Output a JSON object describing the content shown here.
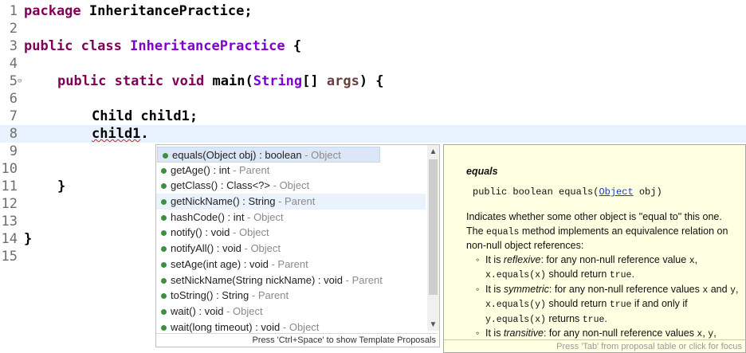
{
  "editor": {
    "lines": [
      {
        "n": "1",
        "tokens": [
          [
            "kw",
            "package"
          ],
          [
            "",
            "InheritancePractice;"
          ]
        ]
      },
      {
        "n": "2",
        "tokens": []
      },
      {
        "n": "3",
        "tokens": [
          [
            "kw",
            "public"
          ],
          [
            "kw",
            "class"
          ],
          [
            "cls",
            "InheritancePractice"
          ],
          [
            "",
            "{"
          ]
        ]
      },
      {
        "n": "4",
        "tokens": []
      },
      {
        "n": "5",
        "tokens": []
      },
      {
        "n": "6",
        "tokens": []
      },
      {
        "n": "7",
        "tokens": []
      },
      {
        "n": "8",
        "tokens": []
      },
      {
        "n": "9",
        "tokens": []
      },
      {
        "n": "10",
        "tokens": []
      },
      {
        "n": "11",
        "tokens": []
      },
      {
        "n": "12",
        "tokens": []
      },
      {
        "n": "13",
        "tokens": []
      },
      {
        "n": "14",
        "tokens": []
      },
      {
        "n": "15",
        "tokens": []
      }
    ],
    "line5_fold_marker": "⊖",
    "line5": {
      "kw1": "public",
      "kw2": "static",
      "kw3": "void",
      "method": "main(",
      "type": "String",
      "rest": "[] ",
      "param": "args",
      "close": ") {"
    },
    "line7": "Child child1;",
    "line8_ident": "child1",
    "line8_dot": ".",
    "line11": "}",
    "line14": "}",
    "line1_pkg_kw": "package",
    "line1_pkg": "InheritancePractice;",
    "line3_kw1": "public",
    "line3_kw2": "class",
    "line3_cls": "InheritancePractice",
    "line3_brace": "{"
  },
  "completion": {
    "items": [
      {
        "sig": "equals(Object obj) : boolean",
        "owner": "Object",
        "selected": true
      },
      {
        "sig": "getAge() : int",
        "owner": "Parent"
      },
      {
        "sig": "getClass() : Class<?>",
        "owner": "Object"
      },
      {
        "sig": "getNickName() : String",
        "owner": "Parent",
        "hover": true
      },
      {
        "sig": "hashCode() : int",
        "owner": "Object"
      },
      {
        "sig": "notify() : void",
        "owner": "Object"
      },
      {
        "sig": "notifyAll() : void",
        "owner": "Object"
      },
      {
        "sig": "setAge(int age) : void",
        "owner": "Parent"
      },
      {
        "sig": "setNickName(String nickName) : void",
        "owner": "Parent"
      },
      {
        "sig": "toString() : String",
        "owner": "Parent"
      },
      {
        "sig": "wait() : void",
        "owner": "Object"
      },
      {
        "sig": "wait(long timeout) : void",
        "owner": "Object"
      }
    ],
    "separator": " - ",
    "footer": "Press 'Ctrl+Space' to show Template Proposals",
    "scroll_up_icon": "▲",
    "scroll_down_icon": "▼"
  },
  "javadoc": {
    "title": "equals",
    "sig_pre": "public boolean equals(",
    "sig_type": "Object",
    "sig_post": " obj)",
    "p1a": "Indicates whether some other object is \"equal to\" this one. The ",
    "p1_code": "equals",
    "p1b": " method implements an equivalence relation on non-null object references:",
    "b1a": "It is ",
    "b1_em": "reflexive",
    "b1b": ": for any non-null reference value ",
    "b1_x": "x",
    "b1c": ", ",
    "b1_code": "x.equals(x)",
    "b1d": " should return ",
    "b1_true": "true",
    "b1e": ".",
    "b2a": "It is ",
    "b2_em": "symmetric",
    "b2b": ": for any non-null reference values ",
    "b2_x": "x",
    "b2c": " and ",
    "b2_y": "y",
    "b2d": ", ",
    "b2_code1": "x.equals(y)",
    "b2e": " should return ",
    "b2_true": "true",
    "b2f": " if and only if ",
    "b2_code2": "y.equals(x)",
    "b2g": " returns ",
    "b2_true2": "true",
    "b2h": ".",
    "b3a": "It is ",
    "b3_em": "transitive",
    "b3b": ": for any non-null reference values ",
    "b3_x": "x",
    "b3c": ", ",
    "b3_y": "y",
    "b3d": ",",
    "footer": "Press 'Tab' from proposal table or click for focus"
  }
}
